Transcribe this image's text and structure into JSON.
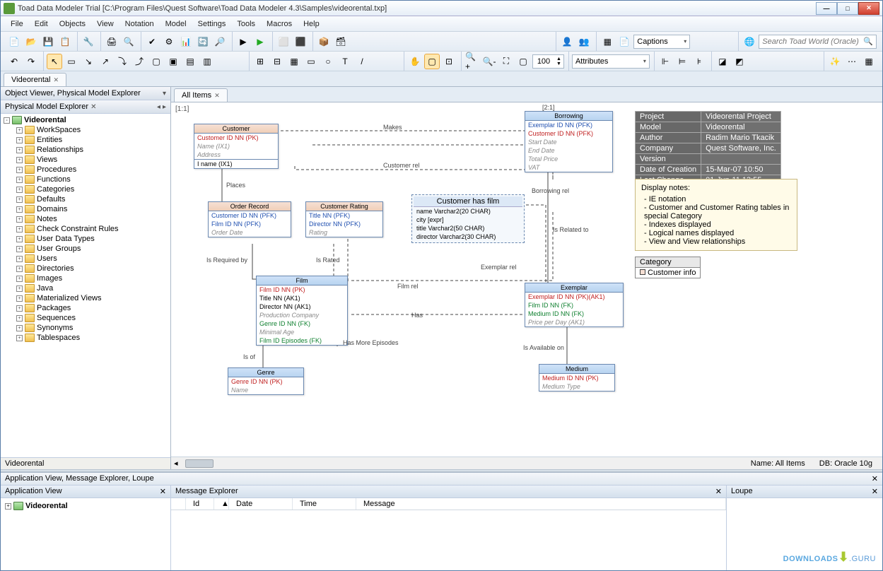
{
  "title": "Toad Data Modeler Trial  [C:\\Program Files\\Quest Software\\Toad Data Modeler 4.3\\Samples\\videorental.txp]",
  "menu": [
    "File",
    "Edit",
    "Objects",
    "View",
    "Notation",
    "Model",
    "Settings",
    "Tools",
    "Macros",
    "Help"
  ],
  "toolbar2": {
    "captions": "Captions",
    "search_placeholder": "Search Toad World (Oracle)"
  },
  "toolbar3": {
    "zoom": "100",
    "displayLevel": "Attributes"
  },
  "docTab": "Videorental",
  "leftPanel": {
    "header": "Object Viewer, Physical Model Explorer",
    "subheader": "Physical Model Explorer",
    "root": "Videorental",
    "nodes": [
      "WorkSpaces",
      "Entities",
      "Relationships",
      "Views",
      "Procedures",
      "Functions",
      "Categories",
      "Defaults",
      "Domains",
      "Notes",
      "Check Constraint Rules",
      "User Data Types",
      "User Groups",
      "Users",
      "Directories",
      "Images",
      "Java",
      "Materialized Views",
      "Packages",
      "Sequences",
      "Synonyms",
      "Tablespaces"
    ],
    "footer": "Videorental"
  },
  "canvas": {
    "tab": "All Items",
    "zoomLabel": "[1:1]",
    "labelBorrowing": "[2:1]",
    "entities": {
      "customer": {
        "title": "Customer",
        "rows": [
          "Customer ID NN  (PK)",
          "Name  (IX1)",
          "Address"
        ],
        "footer": "I name (IX1)"
      },
      "orderRecord": {
        "title": "Order Record",
        "rows": [
          "Customer ID NN  (PFK)",
          "Film ID NN  (PFK)",
          "Order Date"
        ]
      },
      "customerRating": {
        "title": "Customer Rating",
        "rows": [
          "Title NN  (PFK)",
          "Director NN  (PFK)",
          "Rating"
        ]
      },
      "customerHasFilm": {
        "title": "Customer has film",
        "rows": [
          "name    Varchar2(20 CHAR)",
          "city       [expr]",
          "title       Varchar2(50 CHAR)",
          "director  Varchar2(30 CHAR)"
        ]
      },
      "borrowing": {
        "title": "Borrowing",
        "rows": [
          "Exemplar ID NN  (PFK)",
          "Customer ID NN  (PFK)",
          "Start Date",
          "End Date",
          "Total Price",
          "VAT"
        ]
      },
      "film": {
        "title": "Film",
        "rows": [
          "Film ID NN  (PK)",
          "Title NN (AK1)",
          "Director NN (AK1)",
          "Production Company",
          "Genre ID NN  (FK)",
          "Minimal Age",
          "Film ID Episodes  (FK)"
        ]
      },
      "exemplar": {
        "title": "Exemplar",
        "rows": [
          "Exemplar ID NN  (PK)(AK1)",
          "Film ID NN  (FK)",
          "Medium ID NN  (FK)",
          "Price per Day  (AK1)"
        ]
      },
      "genre": {
        "title": "Genre",
        "rows": [
          "Genre ID NN  (PK)",
          "Name"
        ]
      },
      "medium": {
        "title": "Medium",
        "rows": [
          "Medium ID NN  (PK)",
          "Medium Type"
        ]
      }
    },
    "rels": {
      "makes": "Makes",
      "places": "Places",
      "customerRel": "Customer rel",
      "isRequiredBy": "Is Required by",
      "isRated": "Is Rated",
      "filmRel": "Film rel",
      "has": "Has",
      "hasMoreEpisodes": "Has More Episodes",
      "isOf": "Is of",
      "borrowingRel": "Borrowing  rel",
      "isRelatedTo": "Is Related to",
      "exemplarRel": "Exemplar rel",
      "isAvailableOn": "Is Available on"
    },
    "infoTable": [
      [
        "Project",
        "Videorental Project"
      ],
      [
        "Model",
        "Videorental"
      ],
      [
        "Author",
        "Radim Mario Tkacik"
      ],
      [
        "Company",
        "Quest Software, Inc."
      ],
      [
        "Version",
        ""
      ],
      [
        "Date of Creation",
        "15-Mar-07 10:50"
      ],
      [
        "Last Change",
        "01-Jun-11 13:55"
      ]
    ],
    "notes": {
      "header": "Display notes:",
      "items": [
        "- IE notation",
        "- Customer and Customer Rating tables in special Category",
        "- Indexes displayed",
        "- Logical names displayed",
        "- View and View relationships"
      ]
    },
    "category": {
      "header": "Category",
      "item": "Customer info"
    }
  },
  "statusbar": {
    "name": "Name: All Items",
    "db": "DB: Oracle 10g"
  },
  "bottom": {
    "header": "Application View, Message Explorer, Loupe",
    "appView": {
      "title": "Application View",
      "item": "Videorental"
    },
    "msgExplorer": {
      "title": "Message Explorer",
      "cols": [
        "Id",
        "Date",
        "Time",
        "Message"
      ]
    },
    "loupe": {
      "title": "Loupe"
    }
  },
  "watermark": "DOWNLOADS .GURU"
}
